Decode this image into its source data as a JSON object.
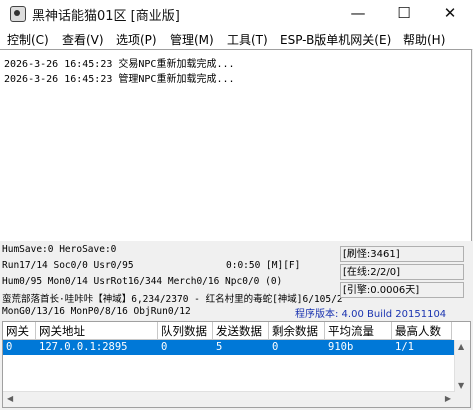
{
  "window": {
    "title": "黑神话能猫01区 [商业版]"
  },
  "menu": [
    "控制(C)",
    "查看(V)",
    "选项(P)",
    "管理(M)",
    "工具(T)",
    "ESP-B版单机网关(E)",
    "帮助(H)"
  ],
  "log_lines": [
    "2026-3-26 16:45:23 交易NPC重新加载完成...",
    "2026-3-26 16:45:23 管理NPC重新加载完成..."
  ],
  "status": {
    "line1": "HumSave:0 HeroSave:0",
    "line2": "Run17/14 Soc0/0 Usr0/95",
    "line2_time": "0:0:50 [M][F]",
    "line3": "Hum0/95 Mon0/14 UsrRot16/344 Merch0/16 Npc0/0 (0)",
    "line4": "蛮荒部落首长·哇咔咔【神域】6,234/2370 - 红名村里的毒蛇[神域]6/105/2",
    "line5": "MonG0/13/16 MonP0/8/16 ObjRun0/12",
    "refresh": "[刷怪:3461]",
    "online": "[在线:2/2/0]",
    "guide": "[引擎:0.0006天]",
    "version": "程序版本: 4.00 Build 20151104"
  },
  "table": {
    "headers": [
      "网关",
      "网关地址",
      "队列数据",
      "发送数据",
      "剩余数据",
      "平均流量",
      "最高人数"
    ],
    "rows": [
      [
        "0",
        "127.0.0.1:2895",
        "0",
        "5",
        "0",
        "910b",
        "1/1"
      ]
    ]
  },
  "colors": {
    "selection": "#0078d7",
    "version_text": "#1a33b0"
  }
}
